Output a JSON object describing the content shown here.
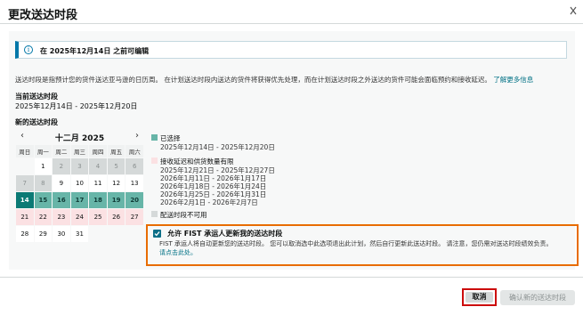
{
  "dialog": {
    "title": "更改送达时段",
    "close_icon": "close-x-icon"
  },
  "info_banner": {
    "icon": "info-icon",
    "text": "在 2025年12月14日 之前可编辑"
  },
  "description": {
    "text": "送达时段是指预计您的货件送达亚马逊的日历周。 在计划送达时段内送达的货件将获得优先处理，而在计划送达时段之外送达的货件可能会面临预约和接收延迟。",
    "link": "了解更多信息"
  },
  "current": {
    "label": "当前送达时段",
    "value": "2025年12月14日 - 2025年12月20日"
  },
  "new_window": {
    "label": "新的送达时段"
  },
  "calendar": {
    "month": "十二月 2025",
    "prev_icon": "chevron-left-icon",
    "next_icon": "chevron-right-icon",
    "weekdays": [
      "周日",
      "周一",
      "周二",
      "周三",
      "周四",
      "周五",
      "周六"
    ],
    "weeks": [
      [
        {
          "d": "",
          "s": "empty"
        },
        {
          "d": "1",
          "s": ""
        },
        {
          "d": "2",
          "s": "unavail"
        },
        {
          "d": "3",
          "s": "unavail"
        },
        {
          "d": "4",
          "s": "unavail"
        },
        {
          "d": "5",
          "s": "unavail"
        },
        {
          "d": "6",
          "s": "unavail"
        }
      ],
      [
        {
          "d": "7",
          "s": "unavail"
        },
        {
          "d": "8",
          "s": "unavail"
        },
        {
          "d": "9",
          "s": ""
        },
        {
          "d": "10",
          "s": ""
        },
        {
          "d": "11",
          "s": ""
        },
        {
          "d": "12",
          "s": ""
        },
        {
          "d": "13",
          "s": ""
        }
      ],
      [
        {
          "d": "14",
          "s": "sel-first"
        },
        {
          "d": "15",
          "s": "sel"
        },
        {
          "d": "16",
          "s": "sel"
        },
        {
          "d": "17",
          "s": "sel"
        },
        {
          "d": "18",
          "s": "sel"
        },
        {
          "d": "19",
          "s": "sel"
        },
        {
          "d": "20",
          "s": "sel"
        }
      ],
      [
        {
          "d": "21",
          "s": "limited"
        },
        {
          "d": "22",
          "s": "limited"
        },
        {
          "d": "23",
          "s": "limited"
        },
        {
          "d": "24",
          "s": "limited"
        },
        {
          "d": "25",
          "s": "limited"
        },
        {
          "d": "26",
          "s": "limited"
        },
        {
          "d": "27",
          "s": "limited"
        }
      ],
      [
        {
          "d": "28",
          "s": ""
        },
        {
          "d": "29",
          "s": ""
        },
        {
          "d": "30",
          "s": ""
        },
        {
          "d": "31",
          "s": ""
        },
        {
          "d": "",
          "s": "empty"
        },
        {
          "d": "",
          "s": "empty"
        },
        {
          "d": "",
          "s": "empty"
        }
      ]
    ]
  },
  "legend": {
    "selected": {
      "title": "已选择",
      "color": "#67b5a8",
      "ranges": [
        "2025年12月14日 - 2025年12月20日"
      ]
    },
    "limited": {
      "title": "接收延迟和供货数量有限",
      "color": "#fbe1e3",
      "ranges": [
        "2025年12月21日 - 2025年12月27日",
        "2026年1月11日 - 2026年1月17日",
        "2026年1月18日 - 2026年1月24日",
        "2026年1月25日 - 2026年1月31日",
        "2026年2月1日 - 2026年2月7日"
      ]
    },
    "unavailable": {
      "title": "配送时段不可用",
      "color": "#d5d9d9"
    }
  },
  "fist": {
    "checked": true,
    "title": "允许 FIST 承运人更新我的送达时段",
    "body": "FIST 承运人将自动更新您的送达时段。 您可以取消选中此选项退出此计划，然后自行更新此送达时段。 请注意，您仍需对送达时段绩效负责。",
    "link": "请点击此处。"
  },
  "footer": {
    "cancel": "取消",
    "confirm": "确认新的送达时段"
  }
}
